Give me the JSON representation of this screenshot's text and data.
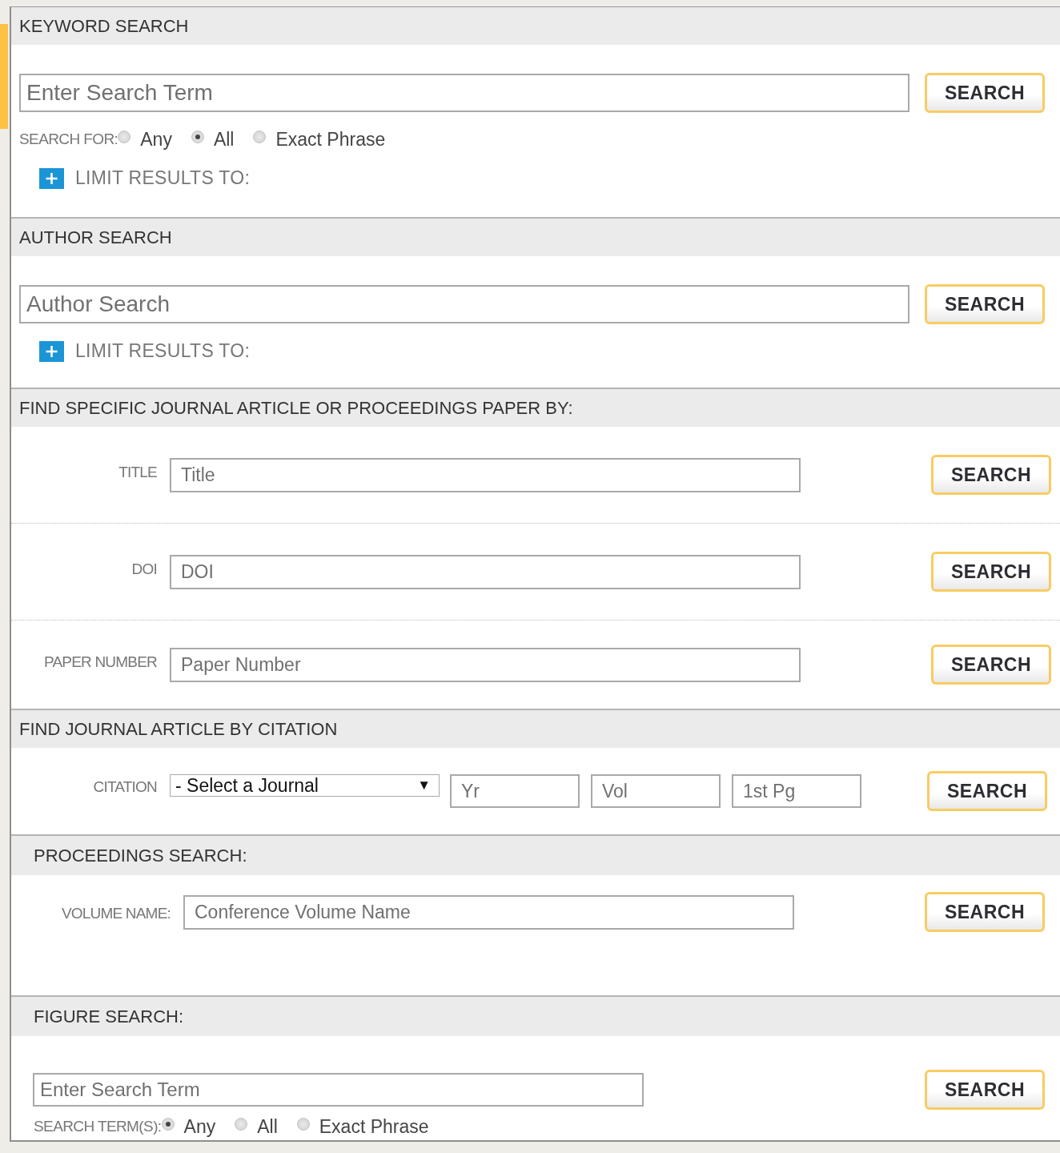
{
  "sections": [
    {
      "kind": "keyword",
      "title": "KEYWORD SEARCH",
      "rows": [
        {
          "kind": "search",
          "placeholder": "Enter Search Term",
          "button": "SEARCH"
        },
        {
          "kind": "radios",
          "label": "SEARCH FOR:",
          "options": [
            {
              "label": "Any",
              "selected": false
            },
            {
              "label": "All",
              "selected": true
            },
            {
              "label": "Exact Phrase",
              "selected": false
            }
          ]
        },
        {
          "kind": "limit",
          "label": "LIMIT RESULTS TO:",
          "expanded": false
        }
      ]
    },
    {
      "kind": "author",
      "title": "AUTHOR SEARCH",
      "rows": [
        {
          "kind": "search",
          "placeholder": "Author Search",
          "button": "SEARCH"
        },
        {
          "kind": "limit",
          "label": "LIMIT RESULTS TO:",
          "expanded": false
        }
      ]
    },
    {
      "kind": "article",
      "title": "FIND SPECIFIC JOURNAL ARTICLE OR PROCEEDINGS PAPER BY:",
      "rows": [
        {
          "kind": "labeled",
          "label": "TITLE",
          "placeholder": "Title",
          "button": "SEARCH"
        },
        {
          "kind": "labeled",
          "label": "DOI",
          "placeholder": "DOI",
          "button": "SEARCH"
        },
        {
          "kind": "labeled",
          "label": "PAPER NUMBER",
          "placeholder": "Paper Number",
          "button": "SEARCH"
        }
      ]
    },
    {
      "kind": "citation",
      "title": "FIND JOURNAL ARTICLE BY CITATION",
      "rows": [
        {
          "kind": "citation",
          "label": "CITATION",
          "select": {
            "value": "- Select a Journal",
            "arrow": "▼"
          },
          "fields": [
            {
              "placeholder": "Yr"
            },
            {
              "placeholder": "Vol"
            },
            {
              "placeholder": "1st Pg"
            }
          ],
          "button": "SEARCH"
        }
      ]
    },
    {
      "kind": "proceedings",
      "title": "PROCEEDINGS SEARCH:",
      "rows": [
        {
          "kind": "labeled",
          "label": "VOLUME NAME:",
          "placeholder": "Conference Volume Name",
          "button": "SEARCH"
        }
      ]
    },
    {
      "kind": "figure",
      "title": "FIGURE SEARCH:",
      "rows": [
        {
          "kind": "search",
          "placeholder": "Enter Search Term",
          "button": "SEARCH"
        },
        {
          "kind": "radios",
          "label": "SEARCH TERM(S):",
          "options": [
            {
              "label": "Any",
              "selected": true
            },
            {
              "label": "All",
              "selected": false
            },
            {
              "label": "Exact Phrase",
              "selected": false
            }
          ]
        }
      ]
    }
  ]
}
